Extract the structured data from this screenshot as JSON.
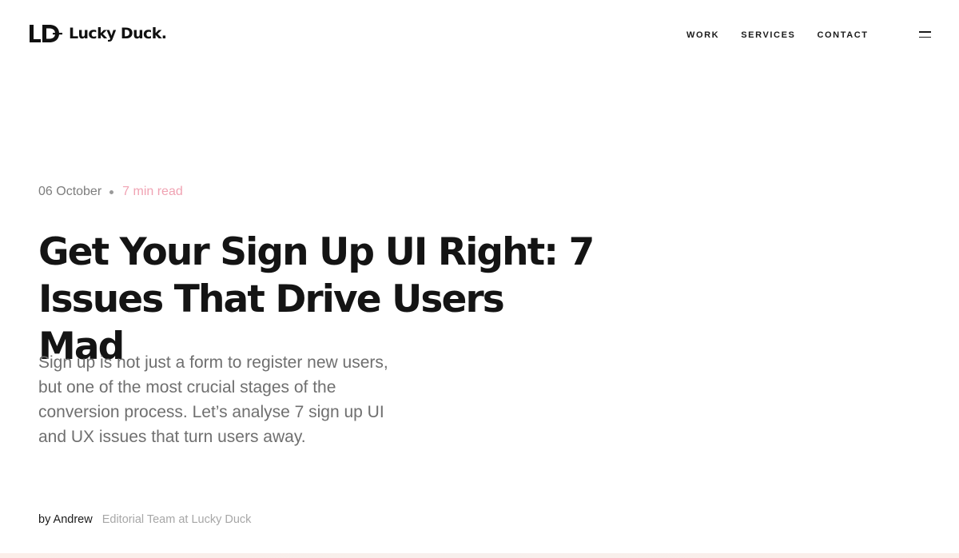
{
  "header": {
    "logo_text": "Lucky Duck.",
    "nav": [
      "WORK",
      "SERVICES",
      "CONTACT"
    ],
    "menu_icon": "hamburger-icon"
  },
  "article": {
    "date": "06 October",
    "read_time": "7 min read",
    "title": "Get Your Sign Up UI Right: 7 Issues That Drive Users Mad",
    "lead": "Sign up is not just a form to register new users, but one of the most crucial stages of the conversion process. Let’s analyse 7 sign up UI and UX issues that turn users away.",
    "author": "by Andrew",
    "author_role": "Editorial Team at Lucky Duck"
  },
  "colors": {
    "text": "#141414",
    "muted": "#6f6f6f",
    "accent_pink": "#f0a3b3"
  }
}
